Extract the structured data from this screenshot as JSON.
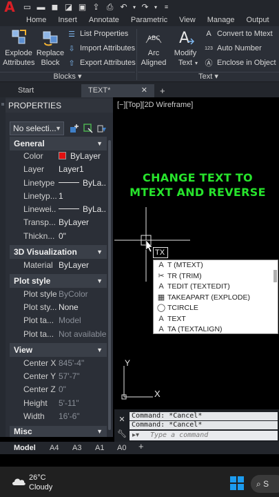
{
  "app": {
    "logo": "A"
  },
  "quick_access": [
    "new-file-icon",
    "open-folder-icon",
    "save-icon",
    "save-as-icon",
    "web-save-icon",
    "export-icon",
    "print-icon",
    "undo-icon",
    "redo-icon",
    "dropdown-icon"
  ],
  "ribbon_tabs": [
    "Home",
    "Insert",
    "Annotate",
    "Parametric",
    "View",
    "Manage",
    "Output"
  ],
  "ribbon": {
    "blocks": {
      "explode_label_1": "Explode",
      "explode_label_2": "Attributes",
      "replace_label_1": "Replace",
      "replace_label_2": "Block",
      "list_properties": "List Properties",
      "import_attributes": "Import Attributes",
      "export_attributes": "Export Attributes",
      "group_label": "Blocks ▾"
    },
    "text": {
      "arc_label_1": "Arc",
      "arc_label_2": "Aligned",
      "modify_label_1": "Modify",
      "modify_label_2": "Text",
      "modify_chevron": "▾",
      "convert": "Convert to Mtext",
      "auto_number": "Auto Number",
      "enclose": "Enclose in Object",
      "group_label": "Text ▾"
    }
  },
  "file_tabs": {
    "start": "Start",
    "active": "TEXT*",
    "close": "✕",
    "add": "+"
  },
  "properties": {
    "header": "PROPERTIES",
    "selection": "No selecti...",
    "sections": {
      "general": "General",
      "viz": "3D Visualization",
      "plot": "Plot style",
      "view": "View",
      "misc": "Misc"
    },
    "general_rows": [
      {
        "label": "Color",
        "value": "ByLayer"
      },
      {
        "label": "Layer",
        "value": "Layer1"
      },
      {
        "label": "Linetype",
        "value": "ByLa..."
      },
      {
        "label": "Linetyp...",
        "value": "1"
      },
      {
        "label": "Linewei...",
        "value": "ByLa..."
      },
      {
        "label": "Transp...",
        "value": "ByLayer"
      },
      {
        "label": "Thickn...",
        "value": "0\""
      }
    ],
    "viz_rows": [
      {
        "label": "Material",
        "value": "ByLayer"
      }
    ],
    "plot_rows": [
      {
        "label": "Plot style",
        "value": "ByColor"
      },
      {
        "label": "Plot sty...",
        "value": "None"
      },
      {
        "label": "Plot ta...",
        "value": "Model"
      },
      {
        "label": "Plot ta...",
        "value": "Not available"
      }
    ],
    "view_rows": [
      {
        "label": "Center X",
        "value": "845'-4\""
      },
      {
        "label": "Center Y",
        "value": "57'-7\""
      },
      {
        "label": "Center Z",
        "value": "0\""
      },
      {
        "label": "Height",
        "value": "5'-11\""
      },
      {
        "label": "Width",
        "value": "16'-6\""
      }
    ]
  },
  "canvas": {
    "view_label": "[−][Top][2D Wireframe]",
    "title_line_1": "CHANGE TEXT TO",
    "title_line_2": "MTEXT AND REVERSE",
    "ucs_y": "Y",
    "ucs_x": "X",
    "typed": "TX"
  },
  "autocomplete": [
    {
      "icon": "A",
      "text": "T (MTEXT)"
    },
    {
      "icon": "✂",
      "text": "TR (TRIM)"
    },
    {
      "icon": "A",
      "text": "TEDIT (TEXTEDIT)"
    },
    {
      "icon": "▦",
      "text": "TAKEAPART (EXPLODE)"
    },
    {
      "icon": "◯",
      "text": "TCIRCLE"
    },
    {
      "icon": "A",
      "text": "TEXT"
    },
    {
      "icon": "A",
      "text": "TA (TEXTALIGN)"
    }
  ],
  "command": {
    "history": [
      "Command: *Cancel*",
      "Command: *Cancel*"
    ],
    "placeholder": "Type a command"
  },
  "layout_tabs": [
    "Model",
    "A4",
    "A3",
    "A1",
    "A0",
    "+"
  ],
  "taskbar": {
    "temp": "26°C",
    "condition": "Cloudy",
    "search": "S"
  },
  "colors": {
    "accent_green": "#27e42c",
    "color_swatch": "#e01010",
    "windows_blue": "#1c9cf0"
  }
}
